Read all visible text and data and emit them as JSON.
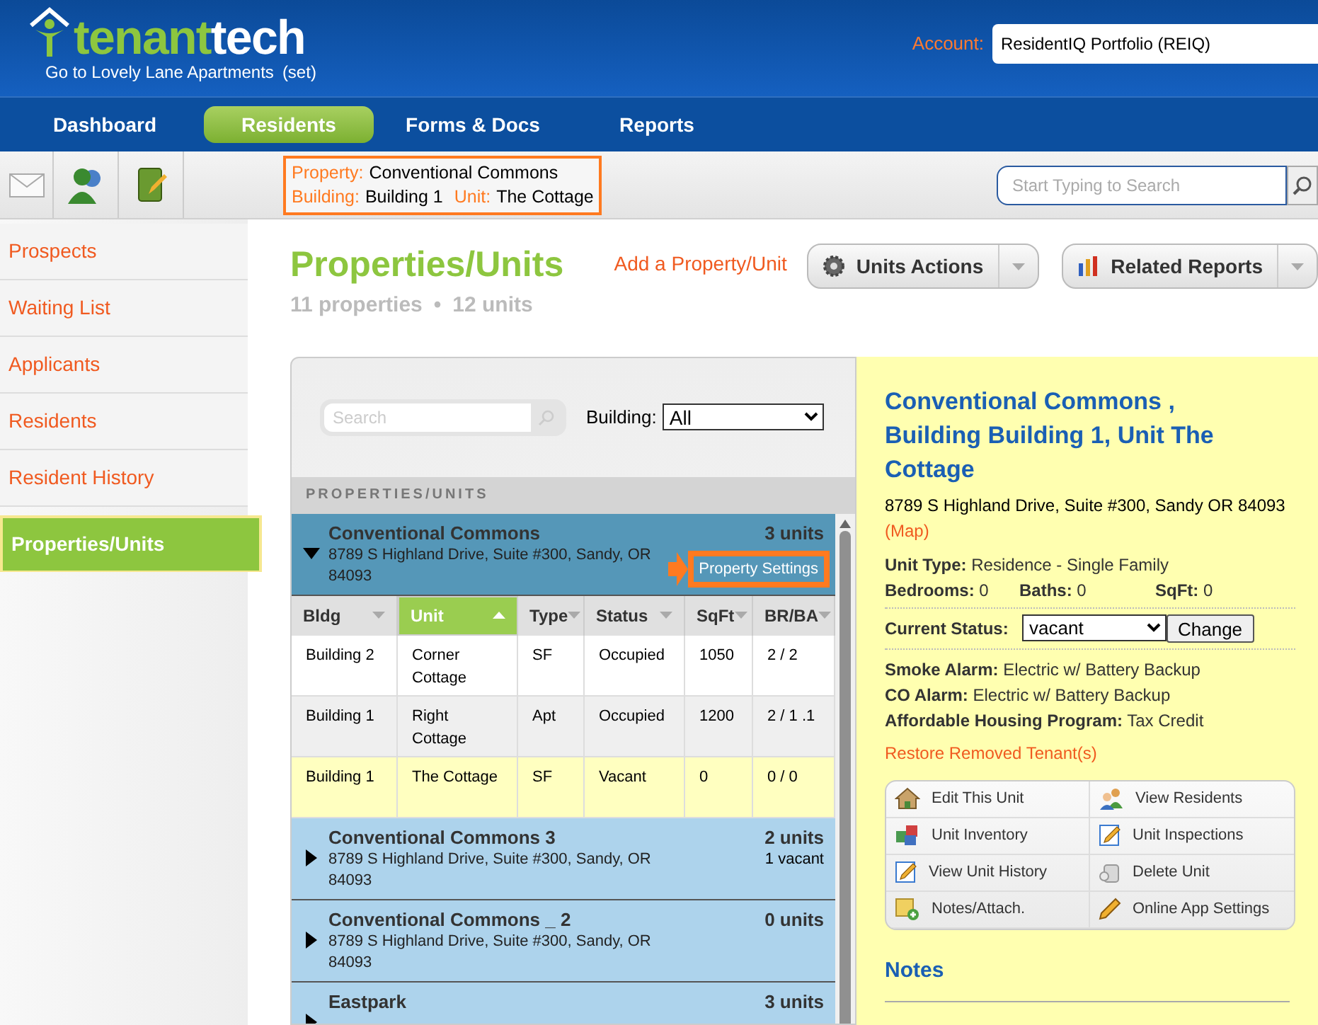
{
  "header": {
    "logo_brand": "tenant",
    "logo_suffix": "tech",
    "property_link": "Go to Lovely Lane Apartments",
    "set_link": "(set)",
    "account_label": "Account:",
    "account_value": "ResidentIQ Portfolio (REIQ)"
  },
  "nav": [
    {
      "label": "Dashboard",
      "selected": false
    },
    {
      "label": "Residents",
      "selected": true
    },
    {
      "label": "Forms & Docs",
      "selected": false
    },
    {
      "label": "Reports",
      "selected": false
    }
  ],
  "context": {
    "property_label": "Property:",
    "property": "Conventional Commons",
    "building_label": "Building:",
    "building": "Building 1",
    "unit_label": "Unit:",
    "unit": "The Cottage"
  },
  "search": {
    "placeholder": "Start Typing to Search"
  },
  "sidebar": {
    "items": [
      {
        "label": "Prospects",
        "selected": false
      },
      {
        "label": "Waiting List",
        "selected": false
      },
      {
        "label": "Applicants",
        "selected": false
      },
      {
        "label": "Residents",
        "selected": false
      },
      {
        "label": "Resident History",
        "selected": false
      },
      {
        "label": "Properties/Units",
        "selected": true
      }
    ]
  },
  "page": {
    "title": "Properties/Units",
    "add_link": "Add a Property/Unit",
    "properties_count": "11 properties",
    "bullet": "•",
    "units_count": "12 units",
    "actions": [
      "Units Actions",
      "Related Reports"
    ]
  },
  "list": {
    "search_placeholder": "Search",
    "building_label": "Building:",
    "building_value": "All",
    "heading": "PROPERTIES/UNITS",
    "settings_label": "Property Settings",
    "columns": [
      {
        "label": "Bldg",
        "selected": false
      },
      {
        "label": "Unit",
        "selected": true
      },
      {
        "label": "Type",
        "selected": false
      },
      {
        "label": "Status",
        "selected": false
      },
      {
        "label": "SqFt",
        "selected": false
      },
      {
        "label": "BR/BA",
        "selected": false
      }
    ],
    "properties": [
      {
        "name": "Conventional Commons",
        "address": "8789 S Highland Drive, Suite #300, Sandy, OR 84093",
        "units": "3 units",
        "expanded": true,
        "rows": [
          {
            "selected": false,
            "cells": [
              "Building 2",
              "Corner Cottage",
              "SF",
              "Occupied",
              "1050",
              "2 / 2"
            ]
          },
          {
            "selected": false,
            "cells": [
              "Building 1",
              "Right Cottage",
              "Apt",
              "Occupied",
              "1200",
              "2 / 1 .1"
            ]
          },
          {
            "selected": true,
            "cells": [
              "Building 1",
              "The Cottage",
              "SF",
              "Vacant",
              "0",
              "0 / 0"
            ]
          }
        ]
      },
      {
        "name": "Conventional Commons 3",
        "address": "8789 S Highland Drive, Suite #300, Sandy, OR 84093",
        "units": "2 units",
        "vacant": "1 vacant",
        "expanded": false
      },
      {
        "name": "Conventional Commons _ 2",
        "address": "8789 S Highland Drive, Suite #300, Sandy, OR 84093",
        "units": "0 units",
        "expanded": false
      },
      {
        "name": "Eastpark",
        "units": "3 units",
        "expanded": false
      }
    ]
  },
  "detail": {
    "title": "Conventional Commons , Building Building 1, Unit The Cottage",
    "address": "8789 S Highland Drive, Suite #300, Sandy OR 84093",
    "map_link": "(Map)",
    "unit_type": "**Unit Type:** Residence - Single Family",
    "stats": [
      "**Bedrooms:** 0",
      "**Baths:** 0",
      "**SqFt:**  0"
    ],
    "status_label": "Current Status:",
    "status_value": "vacant",
    "change_button": "Change",
    "facts": [
      "**Smoke Alarm:** Electric w/ Battery Backup",
      "**CO Alarm:** Electric w/ Battery Backup",
      "**Affordable Housing Program:** Tax Credit"
    ],
    "restore_link": "Restore Removed Tenant(s)",
    "actions": [
      {
        "label": "Edit This Unit",
        "kind": "house"
      },
      {
        "label": "View Residents",
        "kind": "people"
      },
      {
        "label": "Unit Inventory",
        "kind": "boxes"
      },
      {
        "label": "Unit Inspections",
        "kind": "edit"
      },
      {
        "label": "View Unit History",
        "kind": "edit"
      },
      {
        "label": "Delete Unit",
        "kind": "trash"
      },
      {
        "label": "Notes/Attach.",
        "kind": "note"
      },
      {
        "label": "Online App Settings",
        "kind": "pencil"
      }
    ],
    "notes_heading": "Notes"
  }
}
